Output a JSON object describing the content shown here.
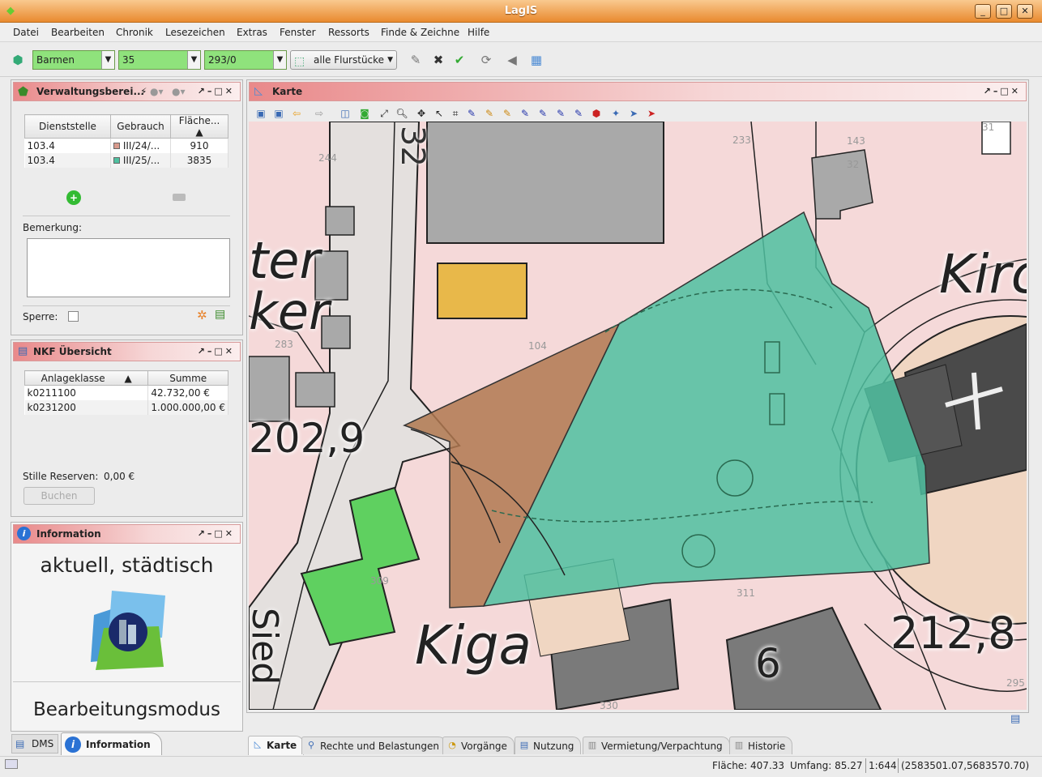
{
  "app": {
    "title": "LagIS"
  },
  "menu": [
    "Datei",
    "Bearbeiten",
    "Chronik",
    "Lesezeichen",
    "Extras",
    "Fenster",
    "Ressorts",
    "Finde & Zeichne",
    "Hilfe"
  ],
  "toolbar": {
    "district": "Barmen",
    "number": "35",
    "parcel": "293/0",
    "filter": "alle Flurstücke"
  },
  "verwaltung": {
    "title": "Verwaltungsberei...",
    "columns": [
      "Dienststelle",
      "Gebrauch",
      "Fläche..."
    ],
    "rows": [
      {
        "dienststelle": "103.4",
        "gebrauch": "III/24/...",
        "flaeche": "910",
        "color": "#d89a8c"
      },
      {
        "dienststelle": "103.4",
        "gebrauch": "III/25/...",
        "flaeche": "3835",
        "color": "#4fc0a0"
      }
    ],
    "remark_label": "Bemerkung:",
    "lock_label": "Sperre:"
  },
  "nkf": {
    "title": "NKF Übersicht",
    "columns": [
      "Anlageklasse",
      "Summe"
    ],
    "rows": [
      {
        "klasse": "k0211100",
        "summe": "42.732,00 €"
      },
      {
        "klasse": "k0231200",
        "summe": "1.000.000,00 €"
      }
    ],
    "reserves_label": "Stille Reserven:",
    "reserves_value": "0,00 €",
    "book_button": "Buchen"
  },
  "information": {
    "title": "Information",
    "status": "aktuell, städtisch",
    "mode": "Bearbeitungsmodus"
  },
  "left_tabs": [
    "DMS",
    "Information"
  ],
  "map": {
    "title": "Karte",
    "labels": {
      "n32": "32",
      "ter": "ter",
      "ker": "ker",
      "n202": "202,9",
      "kiga": "Kiga",
      "kirc": "Kirc",
      "n212": "212,8",
      "n6": "6",
      "sied": "Sied",
      "p244": "244",
      "p233": "233",
      "p143": "143",
      "p32b": "32",
      "p104": "104",
      "p283": "283",
      "p309": "309",
      "p311": "311",
      "p330": "330",
      "p295": "295",
      "p31": "31"
    }
  },
  "bottom_tabs": [
    "Karte",
    "Rechte und Belastungen",
    "Vorgänge",
    "Nutzung",
    "Vermietung/Verpachtung",
    "Historie"
  ],
  "status": {
    "flaeche": "Fläche: 407.33",
    "umfang": "Umfang: 85.27",
    "scale": "1:644",
    "coords": "(2583501.07,5683570.70)"
  },
  "colors": {
    "accent": "#e98a2f",
    "panel_header": "#e9898a",
    "selection_green": "#4fc0a0",
    "selection_brown": "#b07850",
    "building_green": "#5fd060"
  }
}
